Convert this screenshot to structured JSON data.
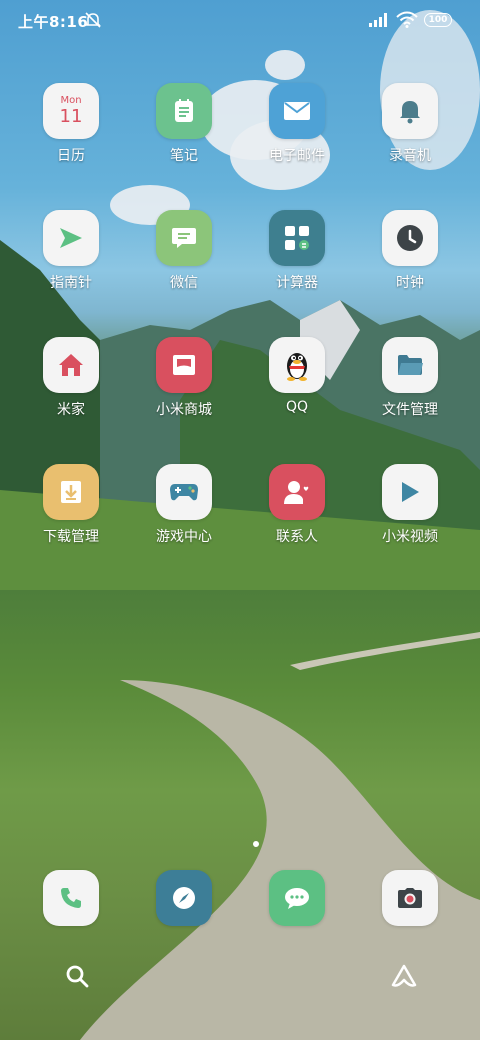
{
  "status_bar": {
    "time": "上午8:16",
    "battery": "100",
    "icons": [
      "mute-alarm-icon",
      "signal-icon",
      "wifi-icon",
      "battery-icon"
    ]
  },
  "calendar_tile": {
    "month": "Mon",
    "day": "11"
  },
  "apps": [
    {
      "label": "日历",
      "icon": "calendar-icon",
      "color": "#f4f4f4"
    },
    {
      "label": "笔记",
      "icon": "notes-icon",
      "color": "#6cc28e"
    },
    {
      "label": "电子邮件",
      "icon": "mail-icon",
      "color": "#4ea2d6"
    },
    {
      "label": "录音机",
      "icon": "bell-icon",
      "color": "#f4f4f4"
    },
    {
      "label": "指南针",
      "icon": "compass-arrow-icon",
      "color": "#f4f4f4"
    },
    {
      "label": "微信",
      "icon": "chat-bubble-icon",
      "color": "#8cc57a"
    },
    {
      "label": "计算器",
      "icon": "calculator-icon",
      "color": "#3e7f8f"
    },
    {
      "label": "时钟",
      "icon": "clock-icon",
      "color": "#f4f4f4"
    },
    {
      "label": "米家",
      "icon": "home-icon",
      "color": "#f4f4f4"
    },
    {
      "label": "小米商城",
      "icon": "store-icon",
      "color": "#d9505f"
    },
    {
      "label": "QQ",
      "icon": "penguin-icon",
      "color": "#f4f4f4"
    },
    {
      "label": "文件管理",
      "icon": "folder-icon",
      "color": "#f4f4f4"
    },
    {
      "label": "下载管理",
      "icon": "download-icon",
      "color": "#e9bf6f"
    },
    {
      "label": "游戏中心",
      "icon": "gamepad-icon",
      "color": "#f4f4f4"
    },
    {
      "label": "联系人",
      "icon": "contacts-icon",
      "color": "#d9505f"
    },
    {
      "label": "小米视频",
      "icon": "play-icon",
      "color": "#f4f4f4"
    }
  ],
  "dock": [
    {
      "icon": "phone-icon",
      "color": "#f4f4f4"
    },
    {
      "icon": "browser-compass-icon",
      "color": "#3d7e97"
    },
    {
      "icon": "messages-icon",
      "color": "#5cc083"
    },
    {
      "icon": "camera-icon",
      "color": "#f4f4f4"
    }
  ],
  "bottom_bar": [
    "search-icon",
    "mi-assistant-icon"
  ],
  "colors": {
    "accent_red": "#d9505f",
    "accent_green": "#5cc083",
    "accent_blue": "#4ea2d6"
  }
}
